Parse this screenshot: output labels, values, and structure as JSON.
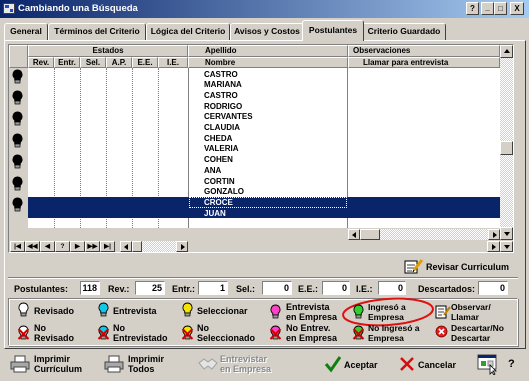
{
  "window": {
    "title": "Cambiando una Búsqueda",
    "help": "?",
    "minimize": "_",
    "maximize": "□",
    "close": "X"
  },
  "colors": {
    "title_start": "#0a246a",
    "title_end": "#a6caf0",
    "selection": "#0a246a",
    "annotation": "#e01010",
    "face": "#d4d0c8"
  },
  "tabs": [
    {
      "label": "General"
    },
    {
      "label": "Términos del Criterio"
    },
    {
      "label": "Lógica del Criterio"
    },
    {
      "label": "Avisos y Costos"
    },
    {
      "label": "Postulantes",
      "active": true
    },
    {
      "label": "Criterio Guardado"
    }
  ],
  "grid": {
    "group_headers": {
      "estados": "Estados",
      "apellido": "Apellido",
      "observaciones": "Observaciones"
    },
    "columns": {
      "estados": [
        "Rev.",
        "Entr.",
        "Sel.",
        "A.P.",
        "E.E.",
        "I.E."
      ],
      "nombre": "Nombre",
      "llamar": "Llamar para entrevista"
    },
    "row_icon": "bulb-black-icon",
    "rows": [
      {
        "apellido": "CASTRO",
        "nombre": "MARIANA"
      },
      {
        "apellido": "CASTRO",
        "nombre": "RODRIGO"
      },
      {
        "apellido": "CERVANTES",
        "nombre": "CLAUDIA"
      },
      {
        "apellido": "CHEDA",
        "nombre": "VALERIA"
      },
      {
        "apellido": "COHEN",
        "nombre": "ANA"
      },
      {
        "apellido": "CORTIN",
        "nombre": "GONZALO"
      },
      {
        "apellido": "CROCE",
        "nombre": "JUAN",
        "selected": true
      }
    ]
  },
  "navigator": {
    "buttons": [
      "|◀",
      "◀◀",
      "◀",
      "?",
      "▶",
      "▶▶",
      "▶|"
    ]
  },
  "revisar": {
    "label": "Revisar Curriculum",
    "icon": "pencil-note-icon"
  },
  "counts": [
    {
      "label": "Postulantes:",
      "value": "118"
    },
    {
      "label": "Rev.:",
      "value": "25"
    },
    {
      "label": "Entr.:",
      "value": "1"
    },
    {
      "label": "Sel.:",
      "value": "0"
    },
    {
      "label": "E.E.:",
      "value": "0"
    },
    {
      "label": "I.E.:",
      "value": "0"
    },
    {
      "label": "Descartados:",
      "value": "0"
    }
  ],
  "legend": {
    "row1": [
      {
        "label": "Revisado",
        "icon": "bulb-white-icon",
        "color": "#ffffff"
      },
      {
        "label": "Entrevista",
        "icon": "bulb-cyan-icon",
        "color": "#10c8e8"
      },
      {
        "label": "Seleccionar",
        "icon": "bulb-yellow-icon",
        "color": "#f4e400"
      },
      {
        "label": "Entrevista\nen Empresa",
        "icon": "bulb-magenta-icon",
        "color": "#ff40c8"
      },
      {
        "label": "Ingresó a\nEmpresa",
        "icon": "bulb-green-icon",
        "color": "#30d030",
        "highlighted": true
      },
      {
        "label": "Observar/\nLlamar",
        "icon": "note-icon"
      }
    ],
    "row2": [
      {
        "label": "No\nRevisado",
        "icon": "bulb-white-x-icon",
        "color": "#ffffff"
      },
      {
        "label": "No\nEntrevistado",
        "icon": "bulb-cyan-x-icon",
        "color": "#10c8e8"
      },
      {
        "label": "No\nSeleccionado",
        "icon": "bulb-yellow-x-icon",
        "color": "#f4e400"
      },
      {
        "label": "No Entrev.\nen Empresa",
        "icon": "bulb-magenta-x-icon",
        "color": "#ff40c8"
      },
      {
        "label": "No Ingresó a\nEmpresa",
        "icon": "bulb-green-x-icon",
        "color": "#30d030"
      },
      {
        "label": "Descartar/No\nDescartar",
        "icon": "discard-icon",
        "color": "#e02020"
      }
    ]
  },
  "actions": [
    {
      "label": "Imprimir\nCurrículum",
      "icon": "printer-icon"
    },
    {
      "label": "Imprimir\nTodos",
      "icon": "printer-icon"
    },
    {
      "label": "Entrevistar\nen Empresa",
      "icon": "handshake-icon",
      "disabled": true
    },
    {
      "label": "Aceptar",
      "icon": "checkmark-icon"
    },
    {
      "label": "Cancelar",
      "icon": "x-mark-icon"
    }
  ],
  "help_label": "?",
  "help_icon": "help-pointer-icon"
}
